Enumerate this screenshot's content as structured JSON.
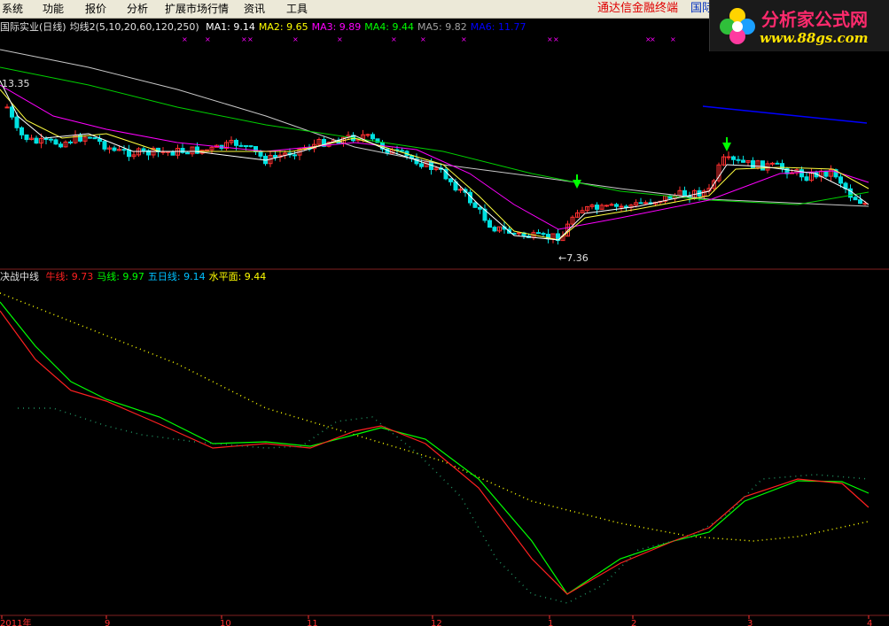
{
  "menu": {
    "items": [
      "系统",
      "功能",
      "报价",
      "分析",
      "扩展市场行情",
      "资讯",
      "工具"
    ],
    "brand": "通达信金融终端",
    "brand_suffix": "国际"
  },
  "logo": {
    "text": "分析家公式网",
    "url": "www.88gs.com"
  },
  "main_panel": {
    "title": "国际实业(日线)",
    "indicator": "均线2(5,10,20,60,120,250)",
    "ma": [
      {
        "label": "MA1:",
        "value": "9.14",
        "color": "#ffffff"
      },
      {
        "label": "MA2:",
        "value": "9.65",
        "color": "#ffff00"
      },
      {
        "label": "MA3:",
        "value": "9.89",
        "color": "#ff00ff"
      },
      {
        "label": "MA4:",
        "value": "9.44",
        "color": "#00ff00"
      },
      {
        "label": "MA5:",
        "value": "9.82",
        "color": "#a0a0a0"
      },
      {
        "label": "MA6:",
        "value": "11.77",
        "color": "#0000ff"
      }
    ],
    "high_label": "13.35",
    "low_label": "←7.36"
  },
  "sub_panel": {
    "title": "决战中线",
    "lines": [
      {
        "label": "牛线:",
        "value": "9.73",
        "color": "#ff2020"
      },
      {
        "label": "马线:",
        "value": "9.97",
        "color": "#00ff00"
      },
      {
        "label": "五日线:",
        "value": "9.14",
        "color": "#00c0ff"
      },
      {
        "label": "水平面:",
        "value": "9.44",
        "color": "#ffff00"
      }
    ]
  },
  "x_axis": {
    "labels": [
      "2011年",
      "9",
      "10",
      "11",
      "12",
      "1",
      "2",
      "3",
      "4"
    ]
  },
  "colors": {
    "up": "#ff3030",
    "down": "#00e0e0",
    "background": "#000000"
  }
}
